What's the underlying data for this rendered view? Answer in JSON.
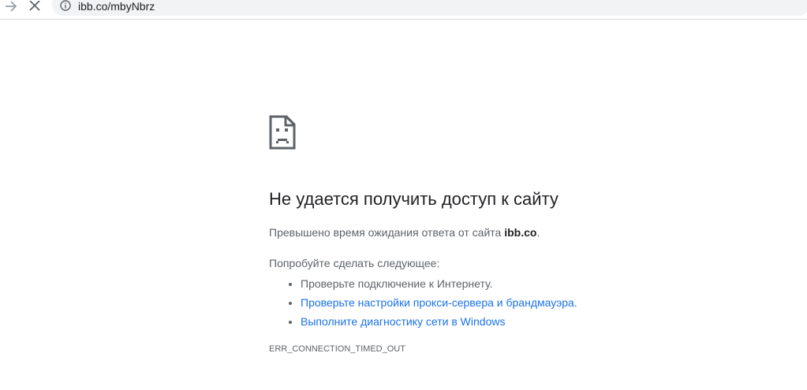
{
  "browser": {
    "url": "ibb.co/mbyNbrz",
    "forward_icon": "arrow-right-icon",
    "stop_icon": "close-icon",
    "site_info_icon": "info-icon"
  },
  "error": {
    "icon": "sad-page-icon",
    "heading": "Не удается получить доступ к сайту",
    "description_prefix": "Превышено время ожидания ответа от сайта ",
    "description_site": "ibb.co",
    "description_suffix": ".",
    "suggestions_title": "Попробуйте сделать следующее:",
    "suggestions": [
      {
        "text": "Проверьте подключение к Интернету.",
        "link": false
      },
      {
        "text": "Проверьте настройки прокси-сервера и брандмауэра.",
        "link": true
      },
      {
        "text": "Выполните диагностику сети в Windows",
        "link": true
      }
    ],
    "code": "ERR_CONNECTION_TIMED_OUT"
  },
  "colors": {
    "link": "#1a73e8",
    "text": "#5f6368",
    "heading": "#202124",
    "omnibox_bg": "#f1f3f4"
  }
}
